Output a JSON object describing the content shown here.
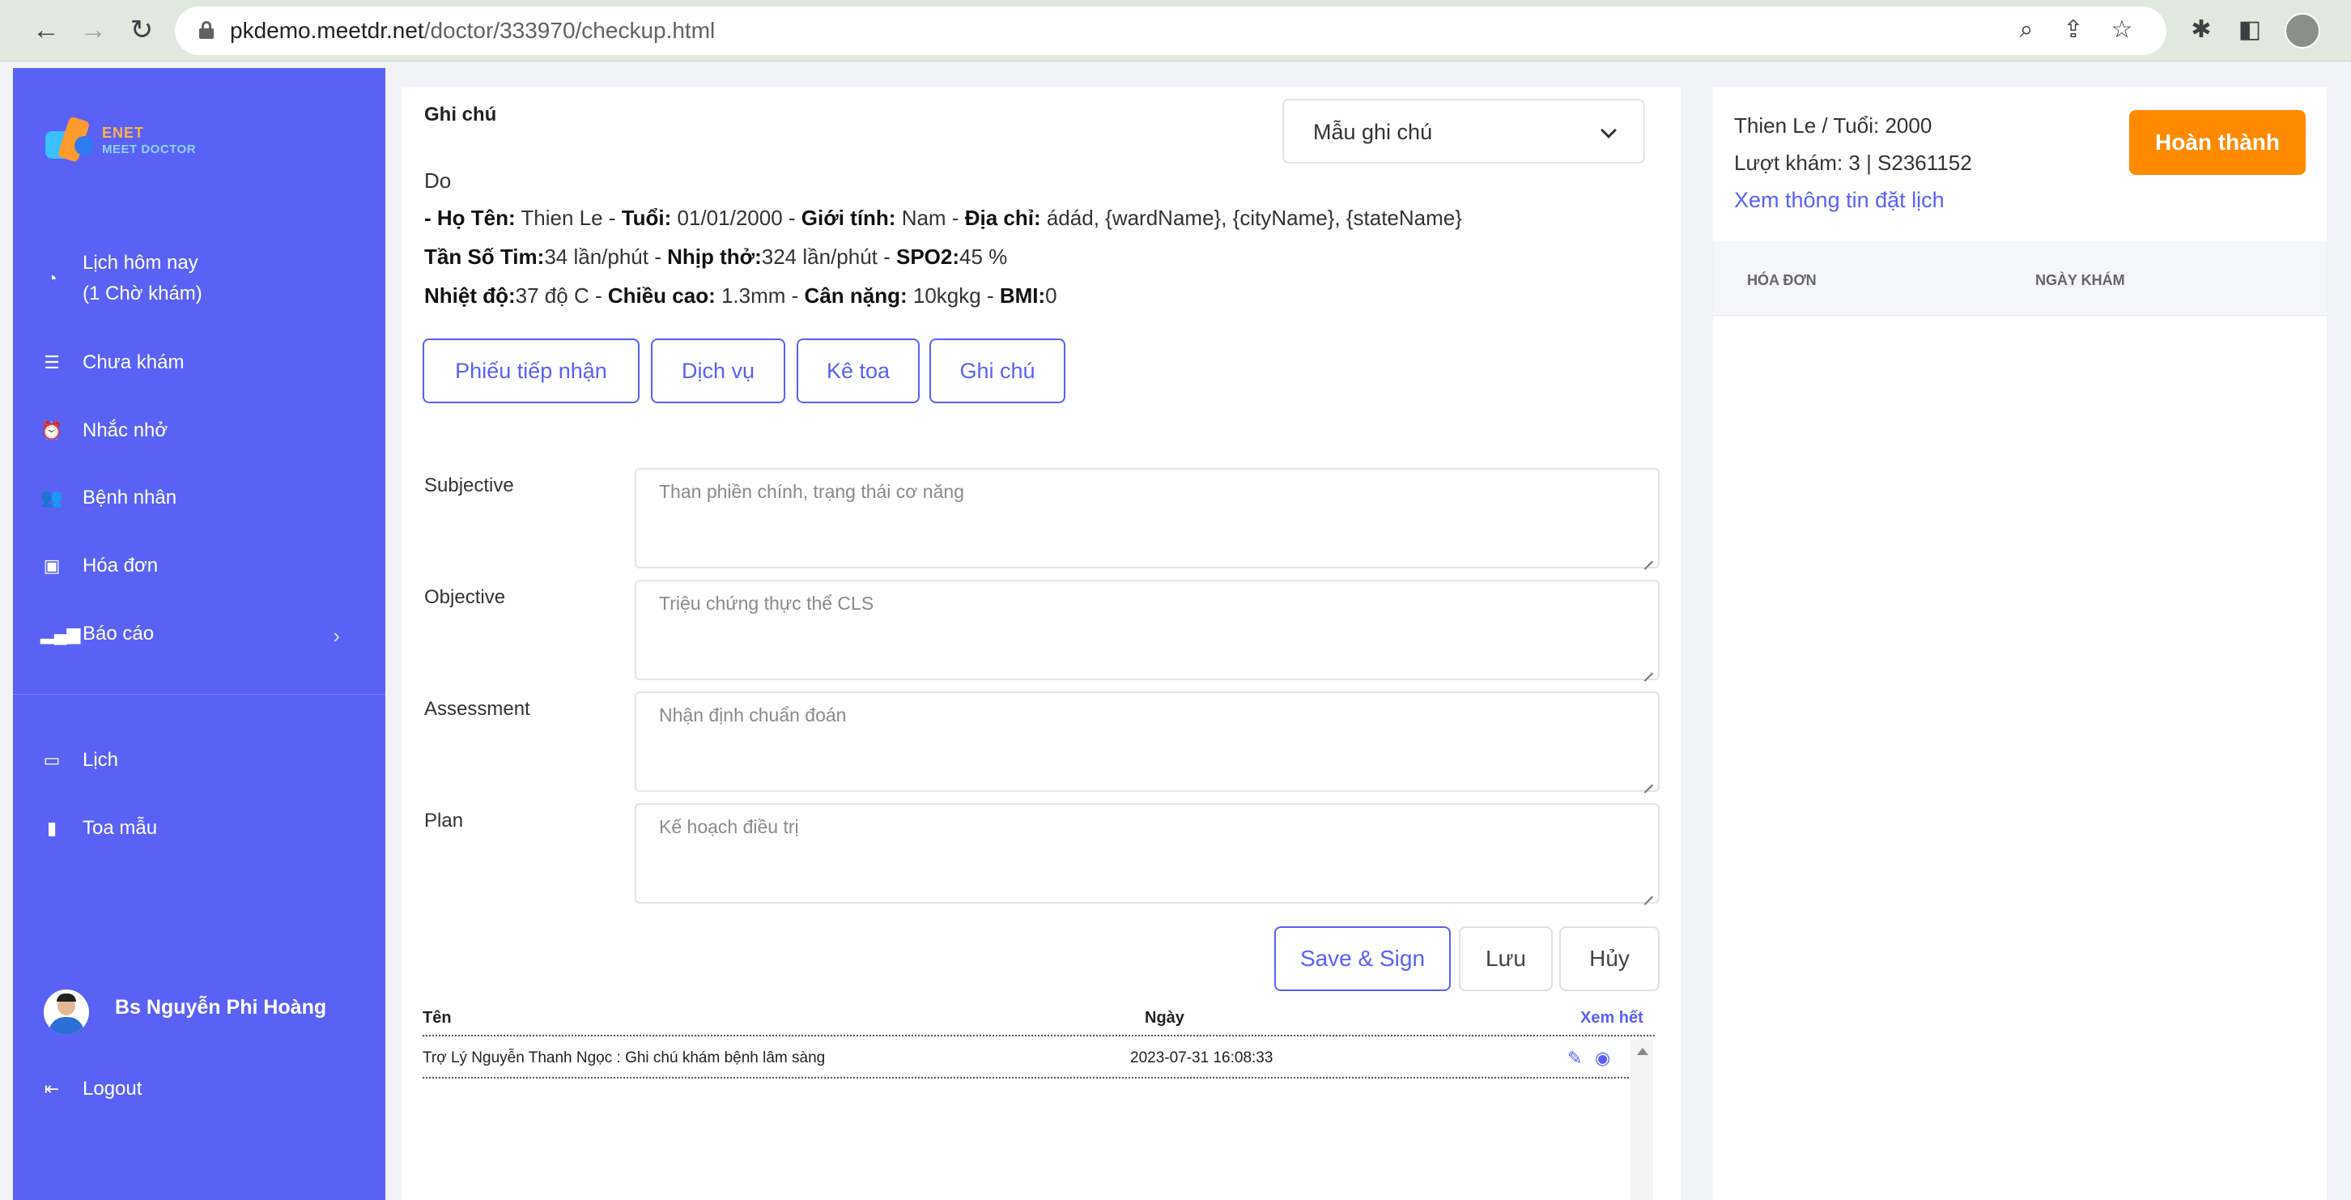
{
  "browser": {
    "url_host": "pkdemo.meetdr.net",
    "url_path": "/doctor/333970/checkup.html"
  },
  "sidebar": {
    "logo_text_1": "ENET",
    "logo_text_2": "MEET DOCTOR",
    "items": [
      {
        "label_1": "Lịch hôm nay",
        "label_2": "(1  Chờ khám)"
      },
      {
        "label": "Chưa khám"
      },
      {
        "label": "Nhắc nhở"
      },
      {
        "label": "Bệnh nhân"
      },
      {
        "label": "Hóa đơn"
      },
      {
        "label": "Báo cáo"
      },
      {
        "label": "Lịch"
      },
      {
        "label": "Toa mẫu"
      }
    ],
    "doctor_name": "Bs Nguyễn Phi Hoàng",
    "logout_label": "Logout"
  },
  "note": {
    "title": "Ghi chú",
    "template_select": "Mẫu ghi chú",
    "intro": "Do",
    "line1": {
      "name_label": "- Họ Tên:",
      "name": " Thien Le - ",
      "age_label": "Tuổi:",
      "dob": " 01/01/2000 - ",
      "gender_label": "Giới tính:",
      "gender": " Nam - ",
      "address_label": "Địa chỉ:",
      "address": " ádád, {wardName}, {cityName}, {stateName}"
    },
    "line2": {
      "hr_label": "Tần Số Tim:",
      "hr": "34 lần/phút - ",
      "rr_label": "Nhịp thở:",
      "rr": "324 lần/phút - ",
      "spo2_label": "SPO2:",
      "spo2": "45 %"
    },
    "line3": {
      "temp_label": "Nhiệt độ:",
      "temp": "37 độ C - ",
      "height_label": "Chiều cao:",
      "height": " 1.3mm - ",
      "weight_label": "Cân nặng:",
      "weight": " 10kgkg - ",
      "bmi_label": "BMI:",
      "bmi": "0"
    },
    "tabs": [
      "Phiếu tiếp nhận",
      "Dịch vụ",
      "Kê toa",
      "Ghi chú"
    ],
    "soap": [
      {
        "label": "Subjective",
        "placeholder": "Than phiền chính, trạng thái cơ năng"
      },
      {
        "label": "Objective",
        "placeholder": "Triệu chứng thực thể CLS"
      },
      {
        "label": "Assessment",
        "placeholder": "Nhận định chuẩn đoán"
      },
      {
        "label": "Plan",
        "placeholder": "Kế hoạch điều trị"
      }
    ],
    "buttons": {
      "save_sign": "Save & Sign",
      "save": "Lưu",
      "cancel": "Hủy"
    },
    "table": {
      "col_name": "Tên",
      "col_date": "Ngày",
      "see_all": "Xem hết",
      "rows": [
        {
          "name": "Trợ Lý Nguyễn Thanh Ngọc : Ghi chú khám bệnh lâm sàng",
          "date": "2023-07-31 16:08:33"
        }
      ]
    }
  },
  "patient": {
    "name_age": "Thien Le / Tuổi: 2000",
    "visits": "Lượt khám: 3 | S2361152",
    "booking_link": "Xem thông tin đặt lịch",
    "complete_button": "Hoàn thành",
    "col_invoice": "HÓA ĐƠN",
    "col_visit_date": "NGÀY KHÁM"
  },
  "colors": {
    "accent": "#5a61f5",
    "complete": "#ff8a00"
  }
}
